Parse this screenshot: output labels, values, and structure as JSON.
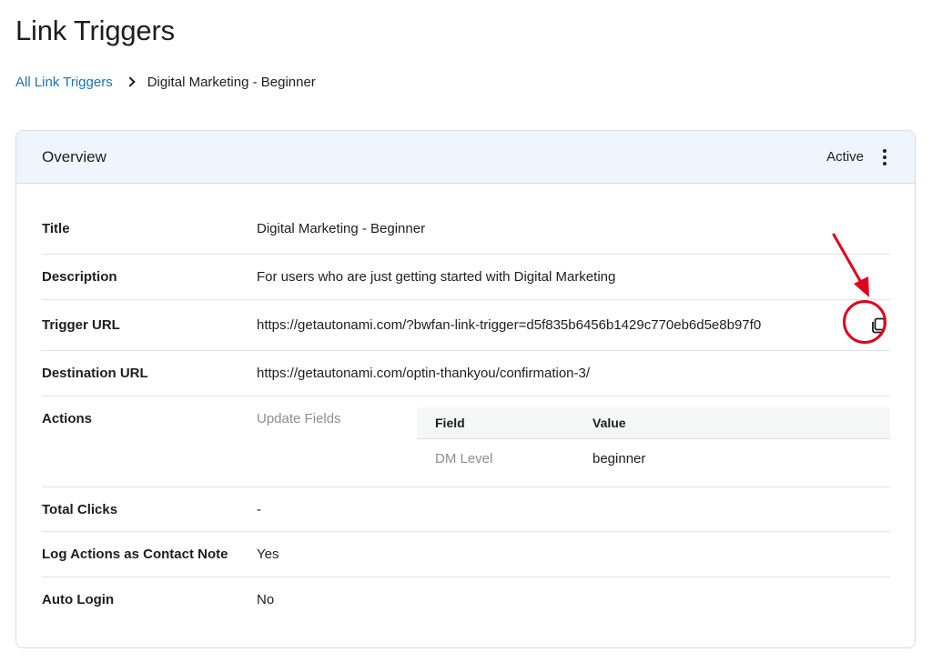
{
  "page": {
    "title": "Link Triggers"
  },
  "breadcrumb": {
    "parent": "All Link Triggers",
    "current": "Digital Marketing - Beginner"
  },
  "overview": {
    "title": "Overview",
    "status": "Active",
    "rows": {
      "title": {
        "label": "Title",
        "value": "Digital Marketing - Beginner"
      },
      "description": {
        "label": "Description",
        "value": "For users who are just getting started with Digital Marketing"
      },
      "trigger_url": {
        "label": "Trigger URL",
        "value": "https://getautonami.com/?bwfan-link-trigger=d5f835b6456b1429c770eb6d5e8b97f0"
      },
      "destination_url": {
        "label": "Destination URL",
        "value": "https://getautonami.com/optin-thankyou/confirmation-3/"
      },
      "actions": {
        "label": "Actions",
        "type": "Update Fields",
        "table": {
          "headers": {
            "field": "Field",
            "value": "Value"
          },
          "rows": [
            {
              "field": "DM Level",
              "value": "beginner"
            }
          ]
        }
      },
      "total_clicks": {
        "label": "Total Clicks",
        "value": "-"
      },
      "log_actions": {
        "label": "Log Actions as Contact Note",
        "value": "Yes"
      },
      "auto_login": {
        "label": "Auto Login",
        "value": "No"
      }
    }
  },
  "colors": {
    "link": "#2271b1",
    "header_bg": "#eef5fd",
    "annotation": "#e0001b"
  },
  "icons": {
    "copy": "copy-icon",
    "more": "more-vertical-icon",
    "breadcrumb_sep": "chevron-right-icon"
  }
}
